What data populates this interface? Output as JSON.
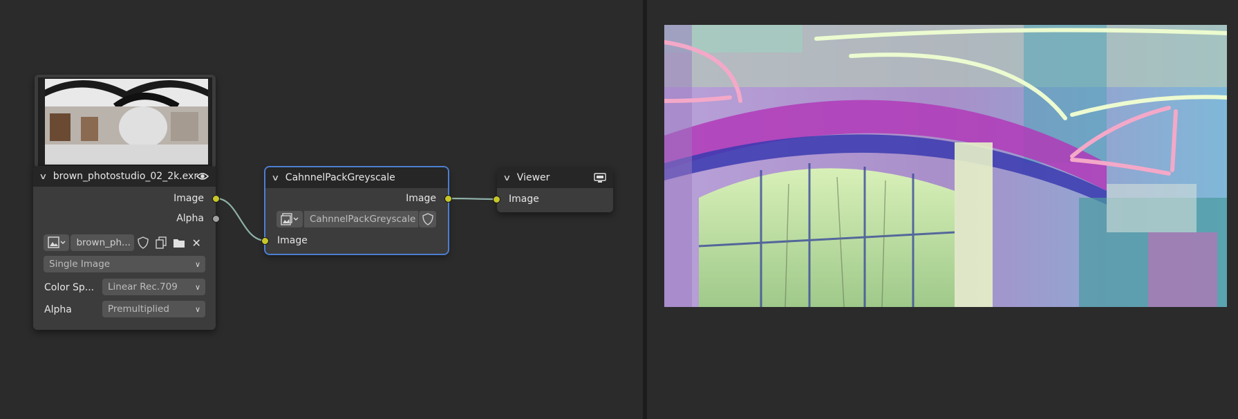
{
  "image_node": {
    "title": "brown_photostudio_02_2k.exr",
    "outputs": [
      "Image",
      "Alpha"
    ],
    "image_name": "brown_ph...",
    "source": "Single Image",
    "color_space_label": "Color Sp...",
    "color_space_value": "Linear Rec.709",
    "alpha_label": "Alpha",
    "alpha_value": "Premultiplied"
  },
  "group_node": {
    "title": "CahnnelPackGreyscale",
    "output": "Image",
    "input": "Image",
    "group_name": "CahnnelPackGreyscale"
  },
  "viewer_node": {
    "title": "Viewer",
    "input": "Image"
  },
  "colors": {
    "editor_bg": "#2b2b2b",
    "node_body": "#3c3c3c",
    "node_header": "#262626",
    "selection": "#4d7fd1",
    "socket_image": "#c7c729",
    "socket_float": "#a1a1a1",
    "wire": "#8fb0a8"
  }
}
